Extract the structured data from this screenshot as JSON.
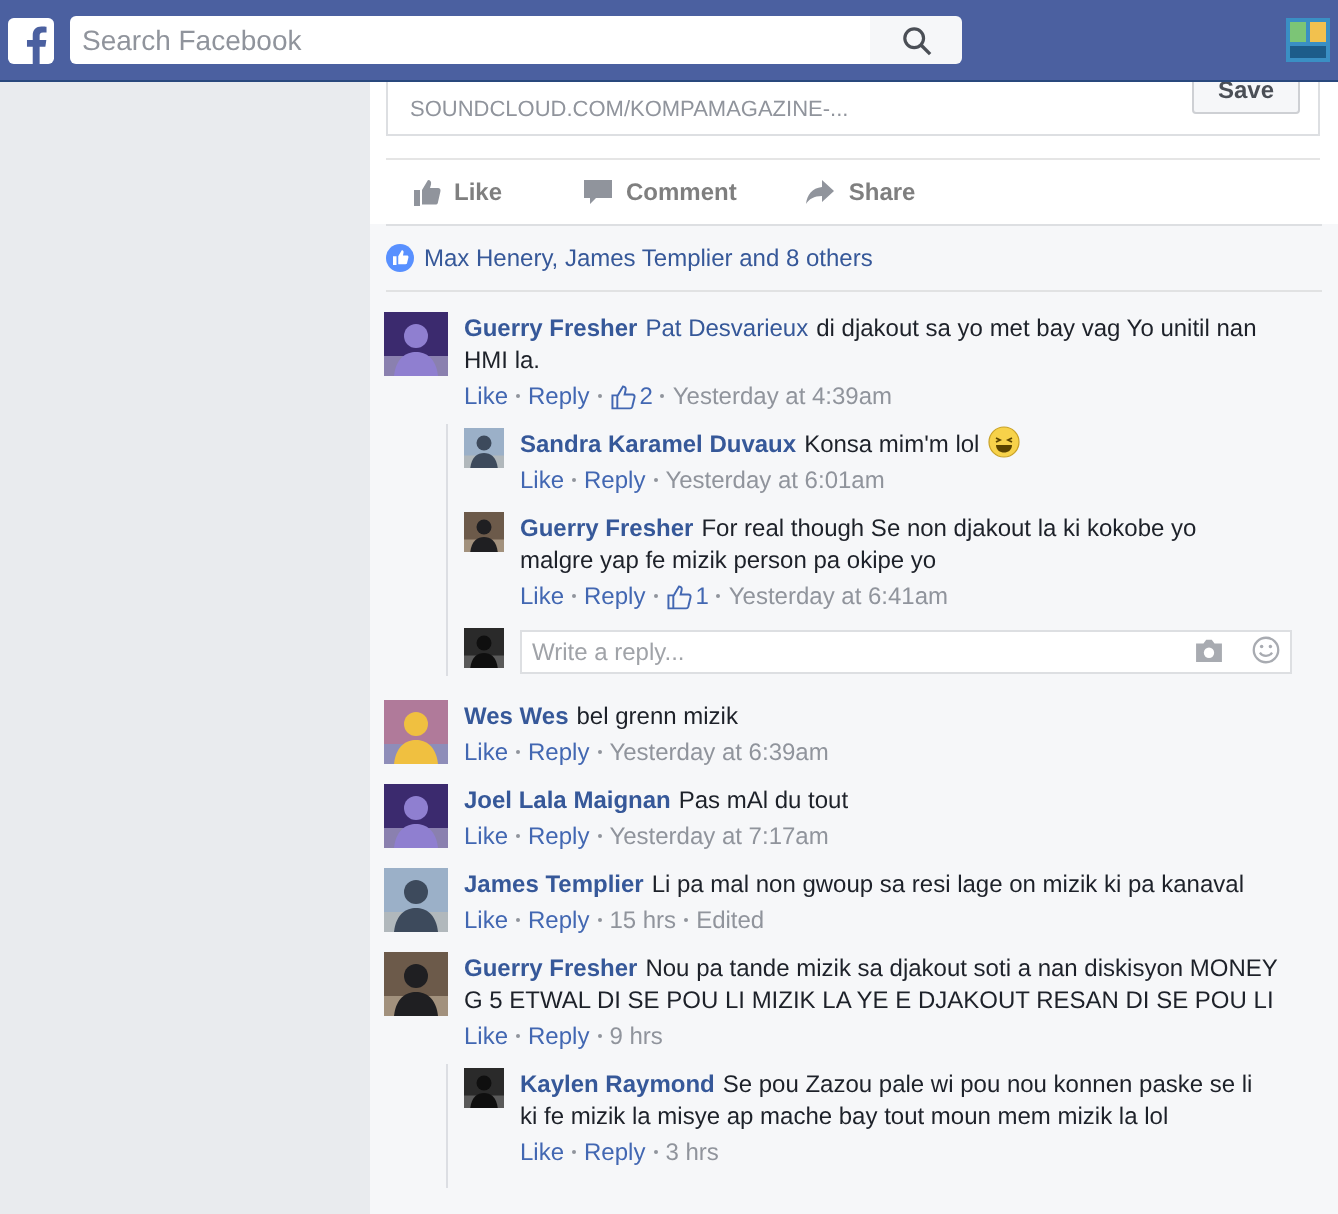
{
  "top_bar": {
    "search": {
      "placeholder": "Search Facebook"
    }
  },
  "post": {
    "link_domain": "SOUNDCLOUD.COM/KOMPAMAGAZINE-...",
    "save_button": "Save",
    "actions": [
      "Like",
      "Comment",
      "Share"
    ],
    "reactions": "Max Henery, James Templier and 8 others"
  },
  "comments": [
    {
      "author": "Guerry Fresher",
      "mention": "Pat Desvarieux",
      "text": "di djakout sa yo met bay vag Yo unitil nan HMI la.",
      "actions": [
        "Like",
        "Reply"
      ],
      "likes": "2",
      "time": "Yesterday at 4:39am",
      "children": [
        {
          "author": "Sandra Karamel Duvaux",
          "text": "Konsa mim'm lol",
          "emoji": true,
          "actions": [
            "Like",
            "Reply"
          ],
          "time": "Yesterday at 6:01am"
        },
        {
          "author": "Guerry Fresher",
          "text": "For real though Se non djakout la ki kokobe yo malgre yap fe mizik person pa okipe yo",
          "actions": [
            "Like",
            "Reply"
          ],
          "likes": "1",
          "time": "Yesterday at 6:41am"
        }
      ],
      "reply_box": {
        "placeholder": "Write a reply..."
      }
    },
    {
      "author": "Wes Wes",
      "text": "bel grenn mizik",
      "actions": [
        "Like",
        "Reply"
      ],
      "time": "Yesterday at 6:39am"
    },
    {
      "author": "Joel Lala Maignan",
      "text": "Pas mAl du tout",
      "actions": [
        "Like",
        "Reply"
      ],
      "time": "Yesterday at 7:17am"
    },
    {
      "author": "James Templier",
      "text": "Li pa mal non gwoup sa resi lage on mizik ki pa kanaval",
      "actions": [
        "Like",
        "Reply"
      ],
      "time": "15 hrs",
      "edited": "Edited"
    },
    {
      "author": "Guerry Fresher",
      "text": "Nou pa tande mizik sa djakout soti a nan diskisyon MONEY G 5 ETWAL DI SE POU LI MIZIK LA YE E DJAKOUT RESAN DI SE POU LI",
      "actions": [
        "Like",
        "Reply"
      ],
      "time": "9 hrs",
      "children": [
        {
          "author": "Kaylen Raymond",
          "text": "Se pou Zazou pale wi pou nou konnen paske se li ki fe mizik la misye ap mache bay tout moun mem mizik la lol",
          "actions": [
            "Like",
            "Reply"
          ],
          "time": "3 hrs"
        }
      ]
    }
  ]
}
